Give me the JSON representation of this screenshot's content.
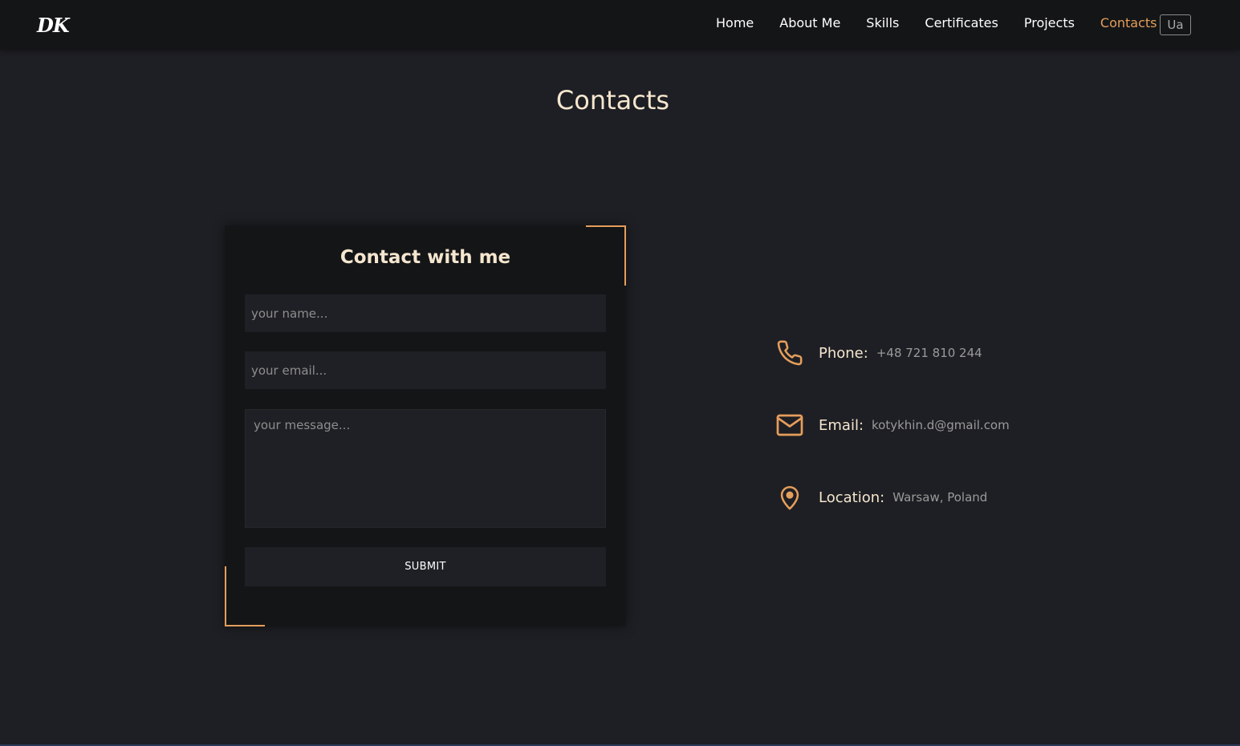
{
  "header": {
    "logo": "DK",
    "nav": [
      {
        "label": "Home"
      },
      {
        "label": "About Me"
      },
      {
        "label": "Skills"
      },
      {
        "label": "Certificates"
      },
      {
        "label": "Projects"
      },
      {
        "label": "Contacts",
        "active": true
      }
    ],
    "lang_button": "Ua"
  },
  "main": {
    "title": "Contacts",
    "form": {
      "title": "Contact with me",
      "name_placeholder": "your name...",
      "email_placeholder": "your email...",
      "message_placeholder": "your message...",
      "submit_label": "SUBMIT"
    },
    "info": {
      "phone": {
        "label": "Phone:",
        "value": "+48 721 810 244",
        "icon": "phone-icon"
      },
      "email": {
        "label": "Email:",
        "value": "kotykhin.d@gmail.com",
        "icon": "mail-icon"
      },
      "location": {
        "label": "Location:",
        "value": "Warsaw, Poland",
        "icon": "location-pin-icon"
      }
    }
  },
  "colors": {
    "accent": "#e59e5b",
    "background": "#1e1f24",
    "header": "#141517",
    "title_text": "#f5e6cf"
  }
}
